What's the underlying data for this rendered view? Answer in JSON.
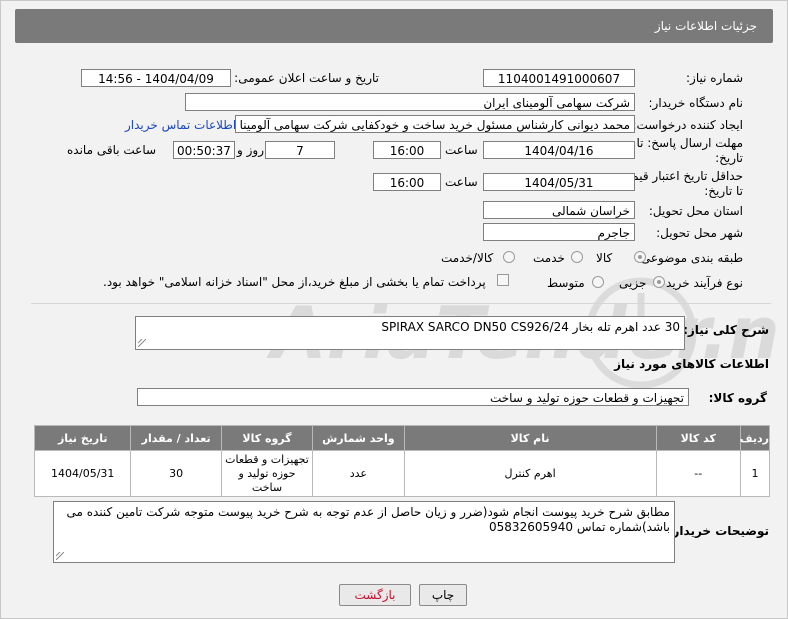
{
  "header": {
    "title": "جزئیات اطلاعات نیاز"
  },
  "fields": {
    "need_number_label": "شماره نیاز:",
    "need_number": "1104001491000607",
    "announce_label": "تاریخ و ساعت اعلان عمومی:",
    "announce_value": "1404/04/09 - 14:56",
    "buyer_org_label": "نام دستگاه خریدار:",
    "buyer_org": "شرکت سهامی آلومینای ایران",
    "creator_label": "ایجاد کننده درخواست:",
    "creator": "محمد دیوانی کارشناس مسئول خرید ساخت و خودکفایی شرکت سهامی آلومینا",
    "contact_link": "اطلاعات تماس خریدار",
    "deadline_label_1": "مهلت ارسال پاسخ: تا",
    "deadline_label_2": "تاریخ:",
    "deadline_date": "1404/04/16",
    "time_label": "ساعت",
    "deadline_time": "16:00",
    "days_value": "7",
    "days_label": "روز و",
    "remaining_value": "00:50:37",
    "remaining_label": "ساعت باقی مانده",
    "validity_label_1": "حداقل تاریخ اعتبار قیمت:",
    "validity_label_2": "تا تاریخ:",
    "validity_date": "1404/05/31",
    "validity_time": "16:00",
    "province_label": "استان محل تحویل:",
    "province": "خراسان شمالی",
    "city_label": "شهر محل تحویل:",
    "city": "جاجرم",
    "category_label": "طبقه بندی موضوعی:",
    "category_options": [
      "کالا",
      "خدمت",
      "کالا/خدمت"
    ],
    "process_label": "نوع فرآیند خرید :",
    "process_options": [
      "جزیی",
      "متوسط"
    ],
    "payment_note": "پرداخت تمام یا بخشی از مبلغ خرید،از محل \"اسناد خزانه اسلامی\" خواهد بود."
  },
  "description": {
    "label": "شرح کلی نیاز:",
    "value": "30 عدد اهرم تله بخار SPIRAX SARCO DN50 CS926/24"
  },
  "goods_section": {
    "title": "اطلاعات کالاهای مورد نیاز",
    "group_label": "گروه کالا:",
    "group_value": "تجهیزات و قطعات حوزه تولید و ساخت"
  },
  "table": {
    "headers": [
      "ردیف",
      "کد کالا",
      "نام کالا",
      "واحد شمارش",
      "گروه کالا",
      "تعداد / مقدار",
      "تاریخ نیاز"
    ],
    "rows": [
      [
        "1",
        "--",
        "اهرم کنترل",
        "عدد",
        "تجهیزات و قطعات حوزه تولید و ساخت",
        "30",
        "1404/05/31"
      ]
    ]
  },
  "notes": {
    "label": "توضیحات خریدار:",
    "value": "مطابق شرح خرید پیوست انجام شود(ضرر و زیان حاصل از عدم توجه به شرح خرید پیوست متوجه شرکت تامین کننده می باشد)شماره تماس 05832605940"
  },
  "buttons": {
    "print": "چاپ",
    "back": "بازگشت"
  },
  "colors": {
    "header_bg": "#7a7a7a",
    "link": "#1a48c4",
    "back_button_text": "#c8102e"
  }
}
